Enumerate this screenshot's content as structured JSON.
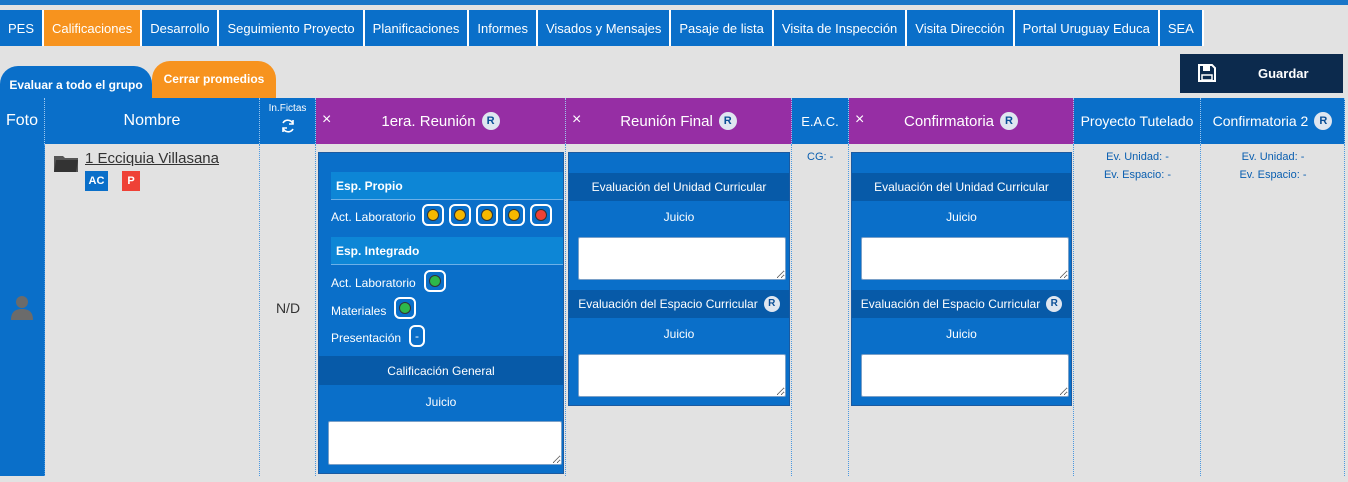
{
  "nav": {
    "tabs": [
      "PES",
      "Calificaciones",
      "Desarrollo",
      "Seguimiento Proyecto",
      "Planificaciones",
      "Informes",
      "Visados y Mensajes",
      "Pasaje de lista",
      "Visita de Inspección",
      "Visita Dirección",
      "Portal Uruguay Educa",
      "SEA"
    ],
    "active": "Calificaciones"
  },
  "subtabs": {
    "evaluate_group": "Evaluar a todo el grupo",
    "close_averages": "Cerrar promedios"
  },
  "toolbar": {
    "save_label": "Guardar",
    "save_icon": "floppy-disk-icon"
  },
  "columns": {
    "foto": "Foto",
    "nombre": "Nombre",
    "inasist": "In.Fictas",
    "first_meeting": "1era. Reunión",
    "final_meeting": "Reunión Final",
    "eac": "E.A.C.",
    "confirmatoria": "Confirmatoria",
    "proyecto": "Proyecto Tutelado",
    "confirmatoria2": "Confirmatoria 2",
    "r_badge": "R",
    "close_x": "×"
  },
  "student": {
    "name": "1 Ecciquia Villasana",
    "badge_ac": "AC",
    "badge_p": "P",
    "inasist": "N/D"
  },
  "first_meeting": {
    "esp_propio": "Esp. Propio",
    "esp_integrado": "Esp. Integrado",
    "act_lab": "Act. Laboratorio",
    "materiales": "Materiales",
    "presentacion": "Presentación",
    "presentacion_value": "-",
    "calif_general": "Calificación General",
    "juicio": "Juicio",
    "propio_dots": [
      "#f5b800",
      "#f5b800",
      "#f5b800",
      "#f5b800",
      "#ef4136"
    ],
    "integrado_lab_dot": "#2db84a",
    "materiales_dot": "#2db84a"
  },
  "final_meeting": {
    "eval_unidad": "Evaluación del Unidad Curricular",
    "juicio": "Juicio",
    "eval_espacio": "Evaluación del Espacio Curricular"
  },
  "eac": {
    "value": "CG: -"
  },
  "confirmatoria": {
    "eval_unidad": "Evaluación del Unidad Curricular",
    "juicio": "Juicio",
    "eval_espacio": "Evaluación del Espacio Curricular"
  },
  "proyecto": {
    "ev_unidad": "Ev. Unidad: -",
    "ev_espacio": "Ev. Espacio: -"
  },
  "confirmatoria2": {
    "ev_unidad": "Ev. Unidad: -",
    "ev_espacio": "Ev. Espacio: -"
  },
  "colors": {
    "primary": "#0a6fc9",
    "accent": "#f7931e",
    "purple": "#962ea4",
    "dark": "#0c2a4d"
  }
}
